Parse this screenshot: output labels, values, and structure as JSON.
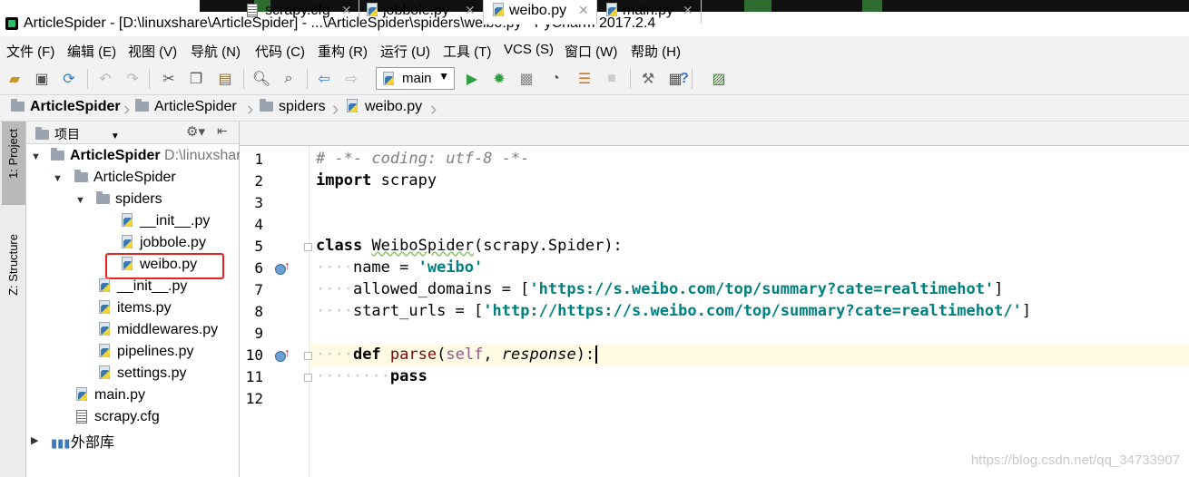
{
  "window": {
    "title": "ArticleSpider - [D:\\linuxshare\\ArticleSpider] - ...\\ArticleSpider\\spiders\\weibo.py - PyCharm 2017.2.4"
  },
  "menu": [
    "文件 (F)",
    "编辑 (E)",
    "视图 (V)",
    "导航 (N)",
    "代码 (C)",
    "重构 (R)",
    "运行 (U)",
    "工具 (T)",
    "VCS (S)",
    "窗口 (W)",
    "帮助 (H)"
  ],
  "toolbar": {
    "run_config": "main"
  },
  "breadcrumb": [
    "ArticleSpider",
    "ArticleSpider",
    "spiders",
    "weibo.py"
  ],
  "side_tabs": {
    "project": "1: Project",
    "structure": "Z: Structure"
  },
  "project_panel": {
    "header": "项目",
    "root": {
      "name": "ArticleSpider",
      "path": "D:\\linuxshare"
    },
    "items": {
      "pkg": "ArticleSpider",
      "spiders": "spiders",
      "spiders_init": "__init__.py",
      "jobbole": "jobbole.py",
      "weibo": "weibo.py",
      "pkg_init": "__init__.py",
      "items": "items.py",
      "middlewares": "middlewares.py",
      "pipelines": "pipelines.py",
      "settings": "settings.py",
      "main": "main.py",
      "scrapy_cfg": "scrapy.cfg",
      "external": "外部库"
    }
  },
  "tabs": [
    "scrapy.cfg",
    "jobbole.py",
    "weibo.py",
    "main.py"
  ],
  "active_tab": "weibo.py",
  "line_numbers": [
    "1",
    "2",
    "3",
    "4",
    "5",
    "6",
    "7",
    "8",
    "9",
    "10",
    "11",
    "12"
  ],
  "code": {
    "l1": "# -*- coding: utf-8 -*-",
    "l2_kw": "import",
    "l2_mod": " scrapy",
    "l5_kw": "class",
    "l5_name": "WeiboSpider",
    "l5_rest": "(scrapy.Spider):",
    "l6_name": "name = ",
    "l6_str": "'weibo'",
    "l7_name": "allowed_domains = [",
    "l7_str": "'https://s.weibo.com/top/summary?cate=realtimehot'",
    "l7_end": "]",
    "l8_name": "start_urls = [",
    "l8_str": "'http://https://s.weibo.com/top/summary?cate=realtimehot/'",
    "l8_end": "]",
    "l10_kw": "def",
    "l10_fn": "parse",
    "l10_self": "self",
    "l10_param": "response",
    "l11_kw": "pass"
  },
  "watermark": "https://blog.csdn.net/qq_34733907",
  "colors": {
    "highlight_box": "#e52222",
    "string": "#008080",
    "keyword": "#000080"
  }
}
